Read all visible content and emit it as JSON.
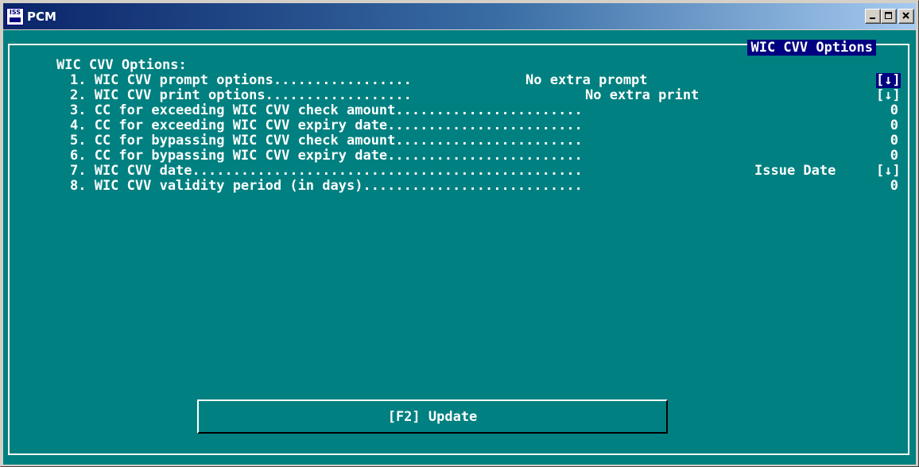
{
  "window": {
    "title": "PCM",
    "icon_text": "ISS",
    "controls": {
      "minimize": "minimize",
      "maximize": "maximize",
      "close": "close"
    }
  },
  "screen": {
    "tab_title": "WIC CVV Options",
    "heading": "WIC CVV Options:",
    "options": [
      {
        "label": "1. WIC CVV prompt options.................",
        "value": "No extra prompt",
        "dropdown": "[↓]",
        "dropdown_highlighted": true
      },
      {
        "label": "2. WIC CVV print options..................",
        "value": "No extra print",
        "dropdown": "[↓]",
        "dropdown_highlighted": false
      },
      {
        "label": "3. CC for exceeding WIC CVV check amount.......................",
        "value": "0"
      },
      {
        "label": "4. CC for exceeding WIC CVV expiry date........................",
        "value": "0"
      },
      {
        "label": "5. CC for bypassing WIC CVV check amount.......................",
        "value": "0"
      },
      {
        "label": "6. CC for bypassing WIC CVV expiry date........................",
        "value": "0"
      },
      {
        "label": "7. WIC CVV date................................................",
        "value": "Issue Date",
        "dropdown": "[↓]"
      },
      {
        "label": "8. WIC CVV validity period (in days)...........................",
        "value": "0"
      }
    ],
    "update_button": "[F2] Update"
  },
  "colors": {
    "background": "#008080",
    "text": "#ffffff",
    "highlight": "#000080",
    "titlebar_start": "#0a246a"
  }
}
